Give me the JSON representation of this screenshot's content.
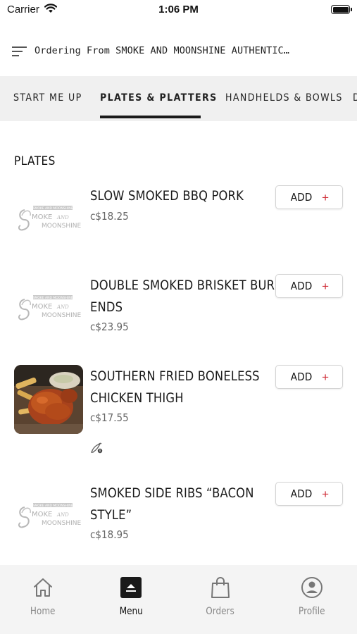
{
  "status_bar": {
    "carrier": "Carrier",
    "time": "1:06 PM"
  },
  "header": {
    "order_text": "Ordering From SMOKE AND MOONSHINE AUTHENTIC…"
  },
  "tabs": [
    {
      "label": "START ME UP"
    },
    {
      "label": "PLATES & PLATTERS",
      "active": true
    },
    {
      "label": "HANDHELDS & BOWLS"
    },
    {
      "label": "D"
    }
  ],
  "section": {
    "title": "PLATES"
  },
  "items": [
    {
      "name_lines": [
        "SLOW SMOKED BBQ PORK"
      ],
      "price": "c$18.25",
      "image": "logo",
      "add_label": "ADD",
      "add_symbol": "+"
    },
    {
      "name_lines": [
        "DOUBLE SMOKED BRISKET BURNT",
        "ENDS"
      ],
      "price": "c$23.95",
      "image": "logo",
      "add_label": "ADD",
      "add_symbol": "+"
    },
    {
      "name_lines": [
        "SOUTHERN FRIED BONELESS",
        "CHICKEN THIGH"
      ],
      "price": "c$17.55",
      "image": "photo-fried-chicken",
      "add_label": "ADD",
      "add_symbol": "+",
      "badge_icon": "spicy-alert-icon"
    },
    {
      "name_lines": [
        "SMOKED SIDE RIBS “BACON",
        "STYLE”"
      ],
      "price": "c$18.95",
      "image": "logo",
      "add_label": "ADD",
      "add_symbol": "+"
    }
  ],
  "logo": {
    "top_text": "SMOKE AND MOONSHINE",
    "line1": "MOKE",
    "line2": "AND",
    "line3": "MOONSHINE"
  },
  "bottom_nav": [
    {
      "label": "Home",
      "icon": "home-icon"
    },
    {
      "label": "Menu",
      "icon": "menu-icon",
      "active": true
    },
    {
      "label": "Orders",
      "icon": "bag-icon"
    },
    {
      "label": "Profile",
      "icon": "profile-icon"
    }
  ],
  "colors": {
    "accent": "#d0303a",
    "tab_bar_bg": "#f0f0f0",
    "nav_bg": "#f4f4f4"
  }
}
